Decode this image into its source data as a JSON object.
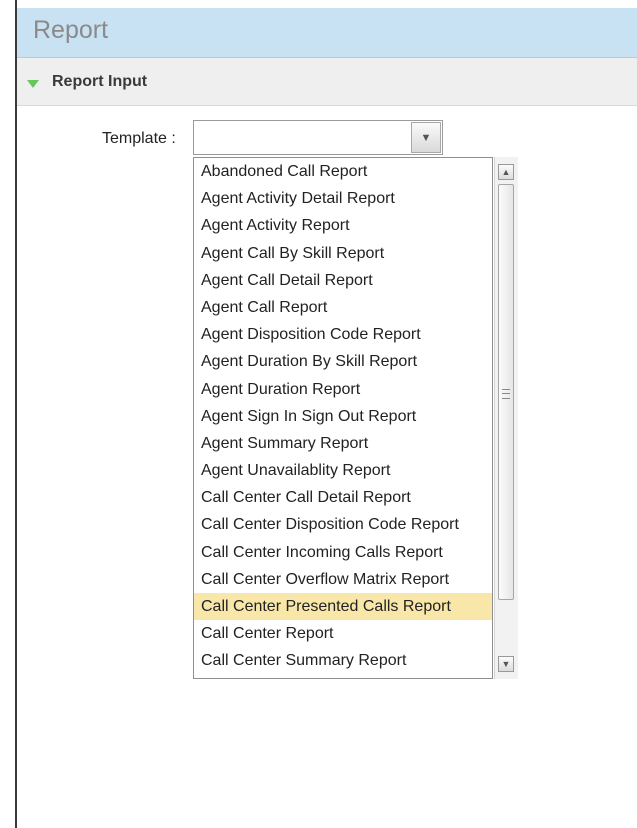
{
  "header": {
    "title": "Report"
  },
  "section": {
    "label": "Report Input"
  },
  "form": {
    "template_label": "Template :",
    "template_value": ""
  },
  "icons": {
    "section_toggle": "triangle-down-icon",
    "combo_toggle": "chevron-down-icon",
    "scroll_up": "arrow-up-icon",
    "scroll_down": "arrow-down-icon"
  },
  "colors": {
    "header_bg": "#c8e1f3",
    "section_bg": "#efefef",
    "toggle_green": "#67c65c",
    "selected_bg": "#f8e7a9"
  },
  "dropdown": {
    "selected_index": 17,
    "items": [
      "Abandoned Call Report",
      "Agent Activity Detail Report",
      "Agent Activity Report",
      "Agent Call By Skill Report",
      "Agent Call Detail Report",
      "Agent Call Report",
      "Agent Disposition Code Report",
      "Agent Duration By Skill Report",
      "Agent Duration Report",
      "Agent Sign In Sign Out Report",
      "Agent Summary Report",
      "Agent Unavailablity Report",
      "Call Center Call Detail Report",
      "Call Center Disposition Code Report",
      "Call Center Incoming Calls Report",
      "Call Center Overflow Matrix Report",
      "Call Center Presented Calls Report",
      "Call Center Report",
      "Call Center Summary Report"
    ]
  }
}
